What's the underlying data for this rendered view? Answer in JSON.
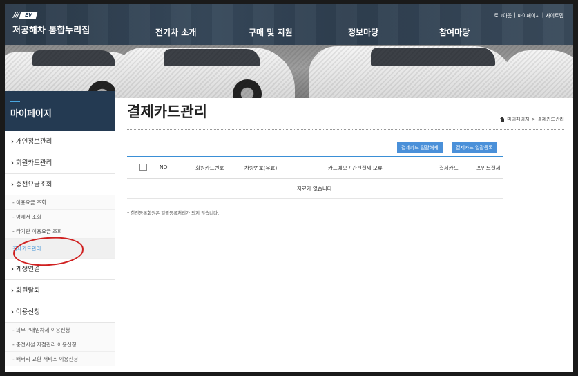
{
  "header": {
    "logo_slashes": "///",
    "logo_badge": "EV",
    "site_title": "저공해차 통합누리집",
    "util_links": [
      "로그아웃",
      "마이페이지",
      "사이트맵"
    ],
    "util_separator": "|",
    "gnb": [
      "전기차 소개",
      "구매 및 지원",
      "정보마당",
      "참여마당"
    ]
  },
  "sidebar": {
    "title": "마이페이지",
    "items": [
      {
        "label": "개인정보관리",
        "arrow": "›"
      },
      {
        "label": "회원카드관리",
        "arrow": "›"
      },
      {
        "label": "충전요금조회",
        "arrow": "›"
      }
    ],
    "sub_items_1": [
      "- 이용요금 조회",
      "- 명세서 조회",
      "- 타기관 이용요금 조회"
    ],
    "active_item": "결제카드관리",
    "items_2": [
      {
        "label": "계정연결",
        "arrow": "›"
      },
      {
        "label": "회원탈퇴",
        "arrow": "›"
      },
      {
        "label": "이용신청",
        "arrow": "›"
      }
    ],
    "sub_items_2": [
      "- 의무구매임차제 이용신청",
      "- 충전시설 지점관리 이용신청",
      "- 배터리 교환 서비스 이용신청"
    ]
  },
  "main": {
    "page_title": "결제카드관리",
    "breadcrumb": [
      "마이페이지",
      "결제카드관리"
    ],
    "breadcrumb_sep": ">",
    "buttons": {
      "bulk_cancel": "결제카드 일괄해제",
      "bulk_register": "결제카드 일괄등록"
    },
    "table": {
      "headers": [
        "NO",
        "회원카드번호",
        "차량번호(유효)",
        "카드에모 / 간편결제 오류",
        "결제카드",
        "포인트결제"
      ],
      "empty_text": "자료가 없습니다."
    },
    "note": "* 한전등록회원은 일괄등록처리가 되지 않습니다."
  },
  "colors": {
    "accent": "#3a8fd6",
    "sidebar_header": "#243a52",
    "button": "#4a90d9",
    "annotation": "#d02020"
  }
}
